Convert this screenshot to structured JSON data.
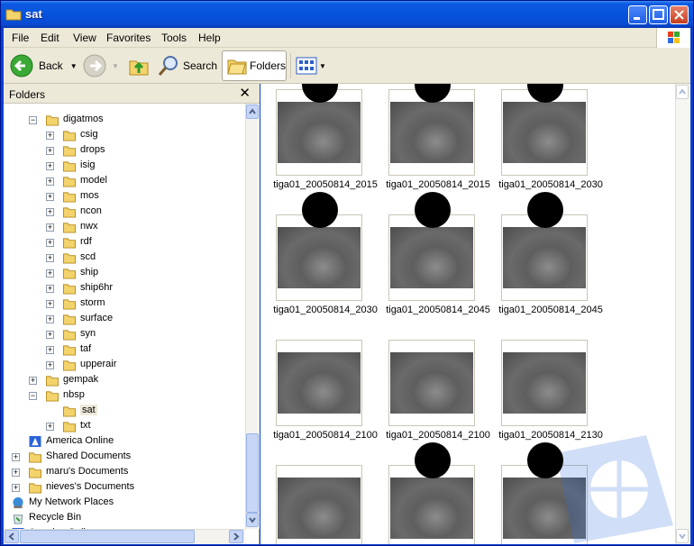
{
  "window": {
    "title": "sat"
  },
  "menu": {
    "items": [
      "File",
      "Edit",
      "View",
      "Favorites",
      "Tools",
      "Help"
    ]
  },
  "toolbar": {
    "back_label": "Back",
    "search_label": "Search",
    "folders_label": "Folders"
  },
  "folders_pane": {
    "title": "Folders",
    "close": "✕",
    "tree": [
      {
        "label": "digatmos",
        "expander": "−"
      },
      {
        "label": "csig",
        "expander": "+"
      },
      {
        "label": "drops",
        "expander": "+"
      },
      {
        "label": "isig",
        "expander": "+"
      },
      {
        "label": "model",
        "expander": "+"
      },
      {
        "label": "mos",
        "expander": "+"
      },
      {
        "label": "ncon",
        "expander": "+"
      },
      {
        "label": "nwx",
        "expander": "+"
      },
      {
        "label": "rdf",
        "expander": "+"
      },
      {
        "label": "scd",
        "expander": "+"
      },
      {
        "label": "ship",
        "expander": "+"
      },
      {
        "label": "ship6hr",
        "expander": "+"
      },
      {
        "label": "storm",
        "expander": "+"
      },
      {
        "label": "surface",
        "expander": "+"
      },
      {
        "label": "syn",
        "expander": "+"
      },
      {
        "label": "taf",
        "expander": "+"
      },
      {
        "label": "upperair",
        "expander": "+"
      },
      {
        "label": "gempak",
        "expander": "+"
      },
      {
        "label": "nbsp",
        "expander": "−"
      },
      {
        "label": "sat",
        "expander": ""
      },
      {
        "label": "txt",
        "expander": "+"
      },
      {
        "label": "America Online",
        "expander": ""
      },
      {
        "label": "Shared Documents",
        "expander": "+"
      },
      {
        "label": "maru's Documents",
        "expander": "+"
      },
      {
        "label": "nieves's Documents",
        "expander": "+"
      },
      {
        "label": "My Network Places",
        "expander": "+"
      },
      {
        "label": "Recycle Bin",
        "expander": ""
      },
      {
        "label": "America Online",
        "expander": ""
      }
    ]
  },
  "files": [
    {
      "name": "tiga01_20050814_2015"
    },
    {
      "name": "tiga01_20050814_2015"
    },
    {
      "name": "tiga01_20050814_2030"
    },
    {
      "name": "tiga01_20050814_2030"
    },
    {
      "name": "tiga01_20050814_2045"
    },
    {
      "name": "tiga01_20050814_2045"
    },
    {
      "name": "tiga01_20050814_2100"
    },
    {
      "name": "tiga01_20050814_2100"
    },
    {
      "name": "tiga01_20050814_2130"
    },
    {
      "name": ""
    },
    {
      "name": ""
    },
    {
      "name": ""
    }
  ]
}
